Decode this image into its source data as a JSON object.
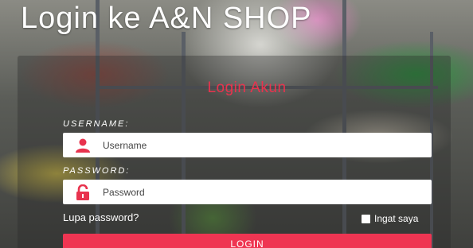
{
  "header": {
    "title": "Login ke A&N SHOP"
  },
  "form": {
    "title": "Login Akun",
    "username_label": "USERNAME:",
    "username_placeholder": "Username",
    "password_label": "PASSWORD:",
    "password_placeholder": "Password",
    "forgot_password": "Lupa password?",
    "remember_me": "Ingat saya",
    "login_button": "LOGIN"
  },
  "colors": {
    "accent": "#ef3552",
    "icon": "#e8334e"
  }
}
